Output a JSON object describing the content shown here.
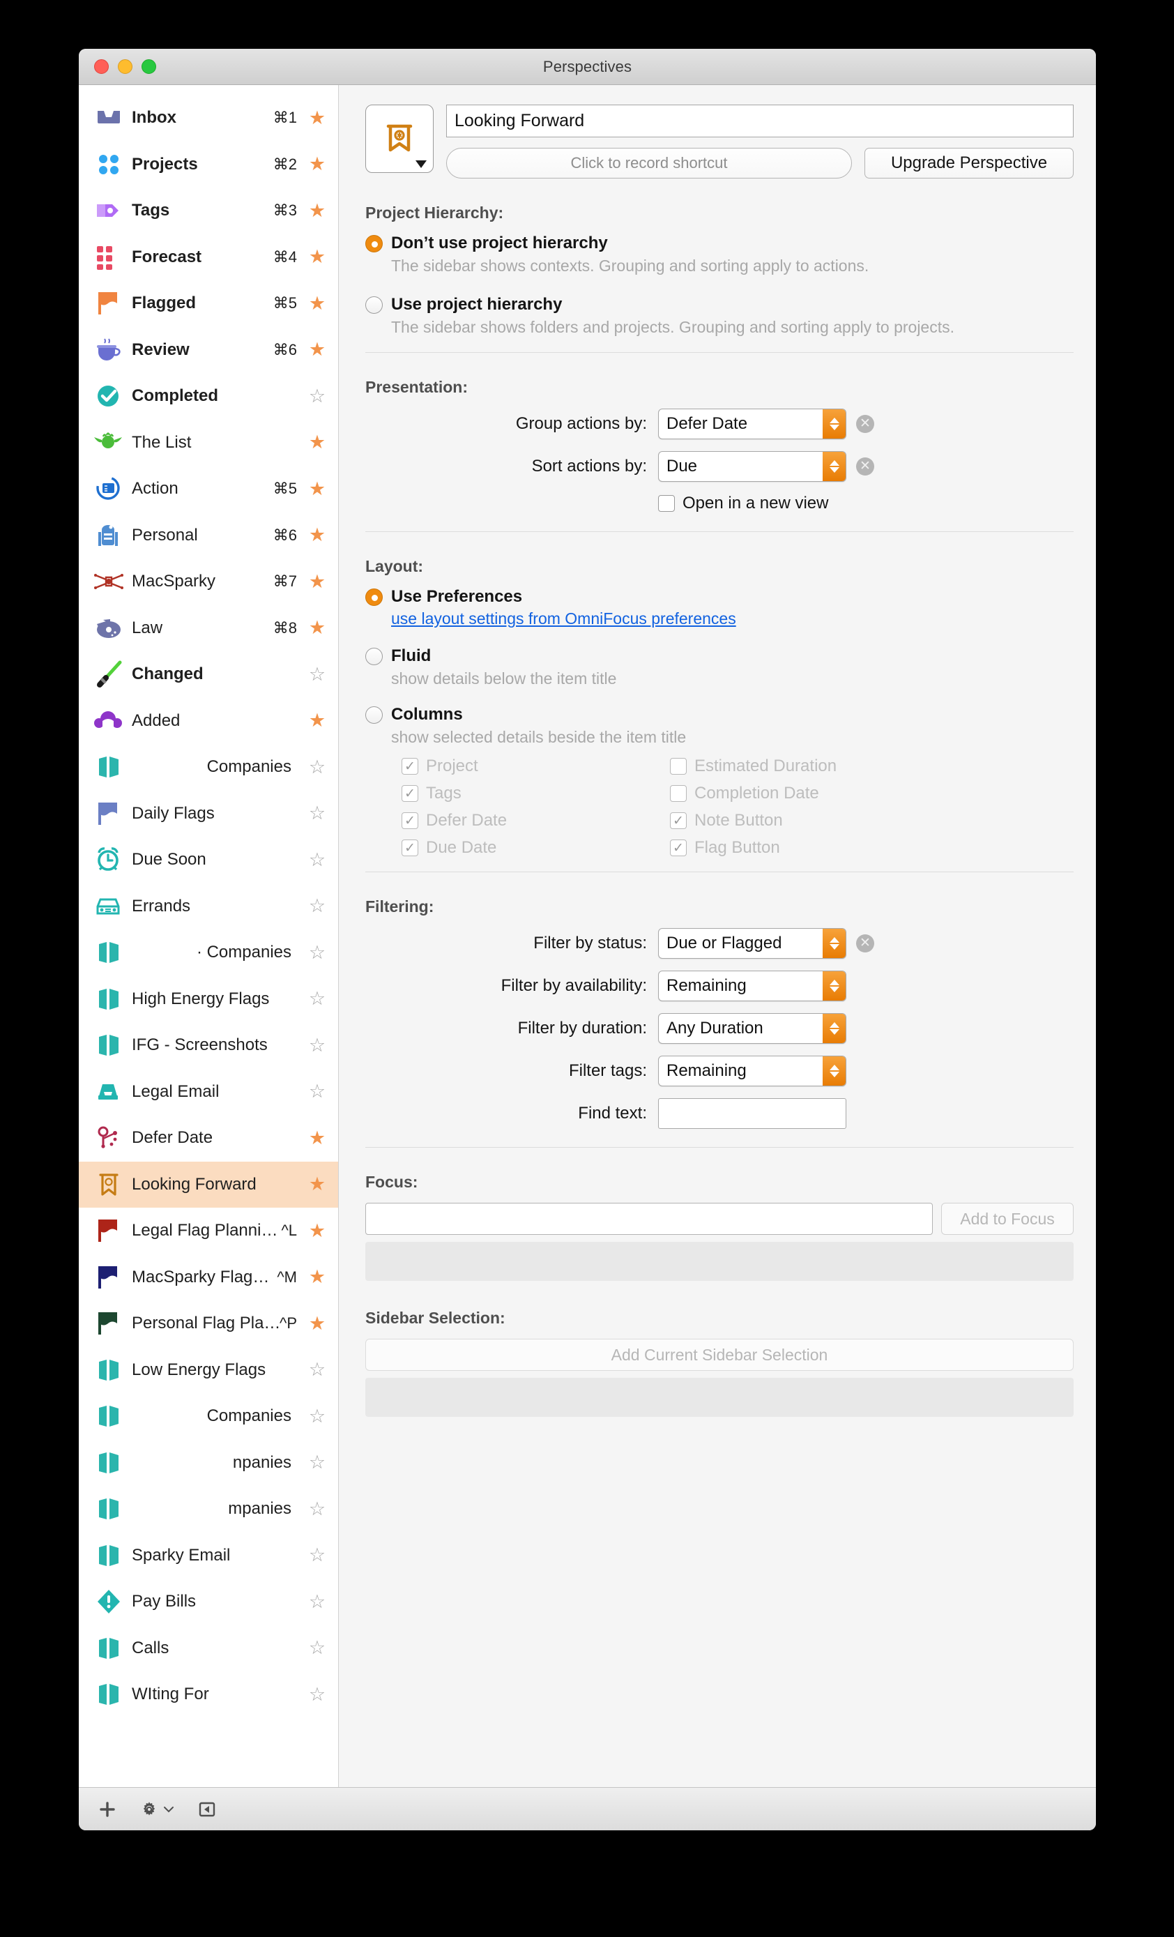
{
  "window": {
    "title": "Perspectives"
  },
  "sidebar": {
    "items": [
      {
        "label": "Inbox",
        "icon": "inbox-icon",
        "shortcut": "⌘1",
        "starred": true,
        "bold": true,
        "align": "left"
      },
      {
        "label": "Projects",
        "icon": "projects-icon",
        "shortcut": "⌘2",
        "starred": true,
        "bold": true,
        "align": "left"
      },
      {
        "label": "Tags",
        "icon": "tag-icon",
        "shortcut": "⌘3",
        "starred": true,
        "bold": true,
        "align": "left"
      },
      {
        "label": "Forecast",
        "icon": "forecast-icon",
        "shortcut": "⌘4",
        "starred": true,
        "bold": true,
        "align": "left"
      },
      {
        "label": "Flagged",
        "icon": "flag-orange-icon",
        "shortcut": "⌘5",
        "starred": true,
        "bold": true,
        "align": "left"
      },
      {
        "label": "Review",
        "icon": "coffee-cup-icon",
        "shortcut": "⌘6",
        "starred": true,
        "bold": true,
        "align": "left"
      },
      {
        "label": "Completed",
        "icon": "check-circle-icon",
        "shortcut": "",
        "starred": false,
        "bold": true,
        "align": "left"
      },
      {
        "label": "The List",
        "icon": "yoda-icon",
        "shortcut": "",
        "starred": true,
        "bold": false,
        "align": "left"
      },
      {
        "label": "Action",
        "icon": "action-icon",
        "shortcut": "⌘5",
        "starred": true,
        "bold": false,
        "align": "left"
      },
      {
        "label": "Personal",
        "icon": "r2d2-icon",
        "shortcut": "⌘6",
        "starred": true,
        "bold": false,
        "align": "left"
      },
      {
        "label": "MacSparky",
        "icon": "xwing-icon",
        "shortcut": "⌘7",
        "starred": true,
        "bold": false,
        "align": "left"
      },
      {
        "label": "Law",
        "icon": "falcon-icon",
        "shortcut": "⌘8",
        "starred": true,
        "bold": false,
        "align": "left"
      },
      {
        "label": "Changed",
        "icon": "lightsaber-icon",
        "shortcut": "",
        "starred": false,
        "bold": true,
        "align": "left"
      },
      {
        "label": "Added",
        "icon": "leia-icon",
        "shortcut": "",
        "starred": true,
        "bold": false,
        "align": "left"
      },
      {
        "label": "Companies",
        "icon": "perspective-icon",
        "shortcut": "",
        "starred": false,
        "bold": false,
        "align": "right"
      },
      {
        "label": "Daily Flags",
        "icon": "flag-blue-icon",
        "shortcut": "",
        "starred": false,
        "bold": false,
        "align": "left"
      },
      {
        "label": "Due Soon",
        "icon": "alarm-clock-icon",
        "shortcut": "",
        "starred": false,
        "bold": false,
        "align": "left"
      },
      {
        "label": "Errands",
        "icon": "car-icon",
        "shortcut": "",
        "starred": false,
        "bold": false,
        "align": "left"
      },
      {
        "label": "· Companies",
        "icon": "perspective-icon",
        "shortcut": "",
        "starred": false,
        "bold": false,
        "align": "right"
      },
      {
        "label": "High Energy Flags",
        "icon": "perspective-icon",
        "shortcut": "",
        "starred": false,
        "bold": false,
        "align": "left"
      },
      {
        "label": "IFG - Screenshots",
        "icon": "perspective-icon",
        "shortcut": "",
        "starred": false,
        "bold": false,
        "align": "left"
      },
      {
        "label": "Legal Email",
        "icon": "tray-icon",
        "shortcut": "",
        "starred": false,
        "bold": false,
        "align": "left"
      },
      {
        "label": "Defer Date",
        "icon": "node-icon",
        "shortcut": "",
        "starred": true,
        "bold": false,
        "align": "left"
      },
      {
        "label": "Looking Forward",
        "icon": "banner-icon",
        "shortcut": "",
        "starred": true,
        "bold": false,
        "align": "left",
        "selected": true
      },
      {
        "label": "Legal Flag Planni…",
        "icon": "flag-red-icon",
        "shortcut": "^L",
        "starred": true,
        "bold": false,
        "align": "left"
      },
      {
        "label": "MacSparky Flag…",
        "icon": "flag-navy-icon",
        "shortcut": "^M",
        "starred": true,
        "bold": false,
        "align": "left"
      },
      {
        "label": "Personal Flag Pla…",
        "icon": "flag-green-icon",
        "shortcut": "^P",
        "starred": true,
        "bold": false,
        "align": "left"
      },
      {
        "label": "Low Energy Flags",
        "icon": "perspective-icon",
        "shortcut": "",
        "starred": false,
        "bold": false,
        "align": "left"
      },
      {
        "label": "Companies",
        "icon": "perspective-icon",
        "shortcut": "",
        "starred": false,
        "bold": false,
        "align": "right"
      },
      {
        "label": "npanies",
        "icon": "perspective-icon",
        "shortcut": "",
        "starred": false,
        "bold": false,
        "align": "right"
      },
      {
        "label": "mpanies",
        "icon": "perspective-icon",
        "shortcut": "",
        "starred": false,
        "bold": false,
        "align": "right"
      },
      {
        "label": "Sparky Email",
        "icon": "perspective-icon",
        "shortcut": "",
        "starred": false,
        "bold": false,
        "align": "left"
      },
      {
        "label": "Pay Bills",
        "icon": "alert-diamond-icon",
        "shortcut": "",
        "starred": false,
        "bold": false,
        "align": "left"
      },
      {
        "label": "Calls",
        "icon": "perspective-icon",
        "shortcut": "",
        "starred": false,
        "bold": false,
        "align": "left"
      },
      {
        "label": "WIting For",
        "icon": "perspective-icon",
        "shortcut": "",
        "starred": false,
        "bold": false,
        "align": "left"
      }
    ]
  },
  "header": {
    "name_value": "Looking Forward",
    "shortcut_placeholder": "Click to record shortcut",
    "upgrade_label": "Upgrade Perspective"
  },
  "project_hierarchy": {
    "title": "Project Hierarchy:",
    "option_no": "Don’t use project hierarchy",
    "option_no_sub": "The sidebar shows contexts. Grouping and sorting apply to actions.",
    "option_yes": "Use project hierarchy",
    "option_yes_sub": "The sidebar shows folders and projects. Grouping and sorting apply to projects.",
    "selected": "no"
  },
  "presentation": {
    "title": "Presentation:",
    "group_label": "Group actions by:",
    "group_value": "Defer Date",
    "sort_label": "Sort actions by:",
    "sort_value": "Due",
    "open_new_view_label": "Open in a new view",
    "open_new_view_checked": false
  },
  "layout": {
    "title": "Layout:",
    "use_prefs": "Use Preferences",
    "use_prefs_link": "use layout settings from OmniFocus preferences",
    "fluid": "Fluid",
    "fluid_sub": "show details below the item title",
    "columns": "Columns",
    "columns_sub": "show selected details beside the item title",
    "selected": "use_prefs",
    "column_options": [
      {
        "label": "Project",
        "checked": true
      },
      {
        "label": "Estimated Duration",
        "checked": false
      },
      {
        "label": "Tags",
        "checked": true
      },
      {
        "label": "Completion Date",
        "checked": false
      },
      {
        "label": "Defer Date",
        "checked": true
      },
      {
        "label": "Note Button",
        "checked": true
      },
      {
        "label": "Due Date",
        "checked": true
      },
      {
        "label": "Flag Button",
        "checked": true
      }
    ]
  },
  "filtering": {
    "title": "Filtering:",
    "status_label": "Filter by status:",
    "status_value": "Due or Flagged",
    "availability_label": "Filter by availability:",
    "availability_value": "Remaining",
    "duration_label": "Filter by duration:",
    "duration_value": "Any Duration",
    "tags_label": "Filter tags:",
    "tags_value": "Remaining",
    "find_label": "Find text:",
    "find_value": ""
  },
  "focus": {
    "title": "Focus:",
    "combo_value": "",
    "add_label": "Add to Focus"
  },
  "sidebar_selection": {
    "title": "Sidebar Selection:",
    "add_label": "Add Current Sidebar Selection"
  },
  "bottombar": {
    "add": "+",
    "gear": "gear-icon",
    "panel": "panel-toggle-icon"
  },
  "colors": {
    "accent": "#ef8b10",
    "selection": "#fbdcc0",
    "link": "#1262e0",
    "teal": "#25b8b0"
  }
}
